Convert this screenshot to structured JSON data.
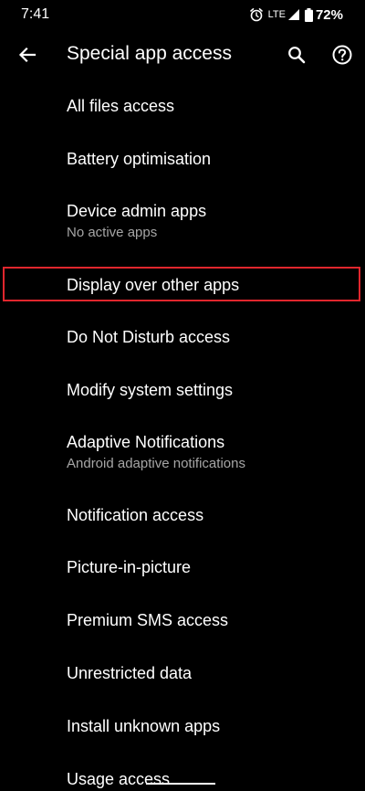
{
  "status_bar": {
    "time": "7:41",
    "network": "LTE",
    "battery": "72%",
    "icons": [
      "alarm-icon",
      "signal-icon",
      "battery-icon"
    ]
  },
  "toolbar": {
    "title": "Special app access",
    "back_icon": "arrow-left-icon",
    "search_icon": "search-icon",
    "help_icon": "help-circle-icon"
  },
  "items": [
    {
      "title": "All files access"
    },
    {
      "title": "Battery optimisation"
    },
    {
      "title": "Device admin apps",
      "subtitle": "No active apps"
    },
    {
      "title": "Display over other apps",
      "highlighted": true
    },
    {
      "title": "Do Not Disturb access"
    },
    {
      "title": "Modify system settings"
    },
    {
      "title": "Adaptive Notifications",
      "subtitle": "Android adaptive notifications"
    },
    {
      "title": "Notification access"
    },
    {
      "title": "Picture-in-picture"
    },
    {
      "title": "Premium SMS access"
    },
    {
      "title": "Unrestricted data"
    },
    {
      "title": "Install unknown apps"
    },
    {
      "title": "Usage access"
    }
  ],
  "colors": {
    "background": "#000000",
    "text_primary": "#ffffff",
    "text_secondary": "#a6a6a6",
    "highlight_border": "#e0262d"
  }
}
